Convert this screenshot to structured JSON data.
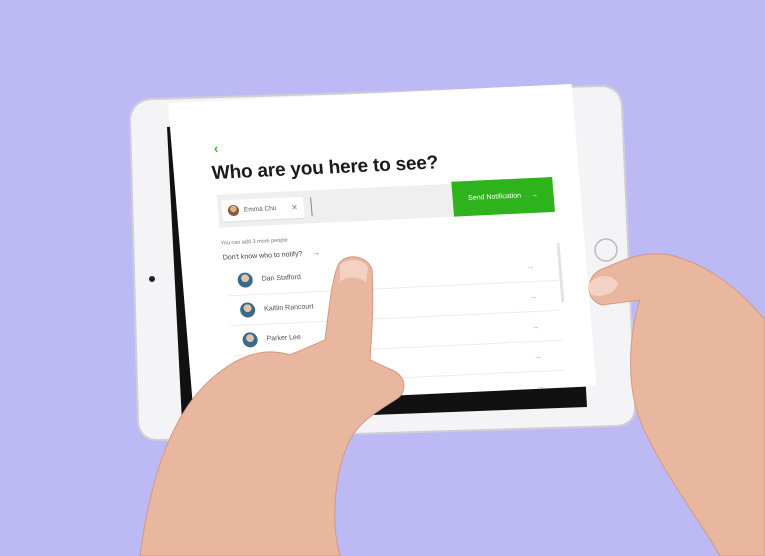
{
  "header": {
    "back_icon": "chevron-left-icon",
    "title": "Who are you here to see?"
  },
  "recipients": [
    {
      "name": "Emma Chu",
      "remove_icon": "close-icon"
    }
  ],
  "send_button": {
    "label": "Send Notification",
    "icon": "arrow-right-icon"
  },
  "hint": "You can add 3 more people",
  "notify_link": {
    "label": "Don't know who to notify?",
    "icon": "arrow-right-icon"
  },
  "people": [
    {
      "name": "Dan Stafford"
    },
    {
      "name": "Kaitlin Rancourt"
    },
    {
      "name": "Parker Lee"
    },
    {
      "name": ""
    },
    {
      "name": ""
    }
  ],
  "colors": {
    "accent": "#2fb31c",
    "background": "#bdb9f5"
  }
}
